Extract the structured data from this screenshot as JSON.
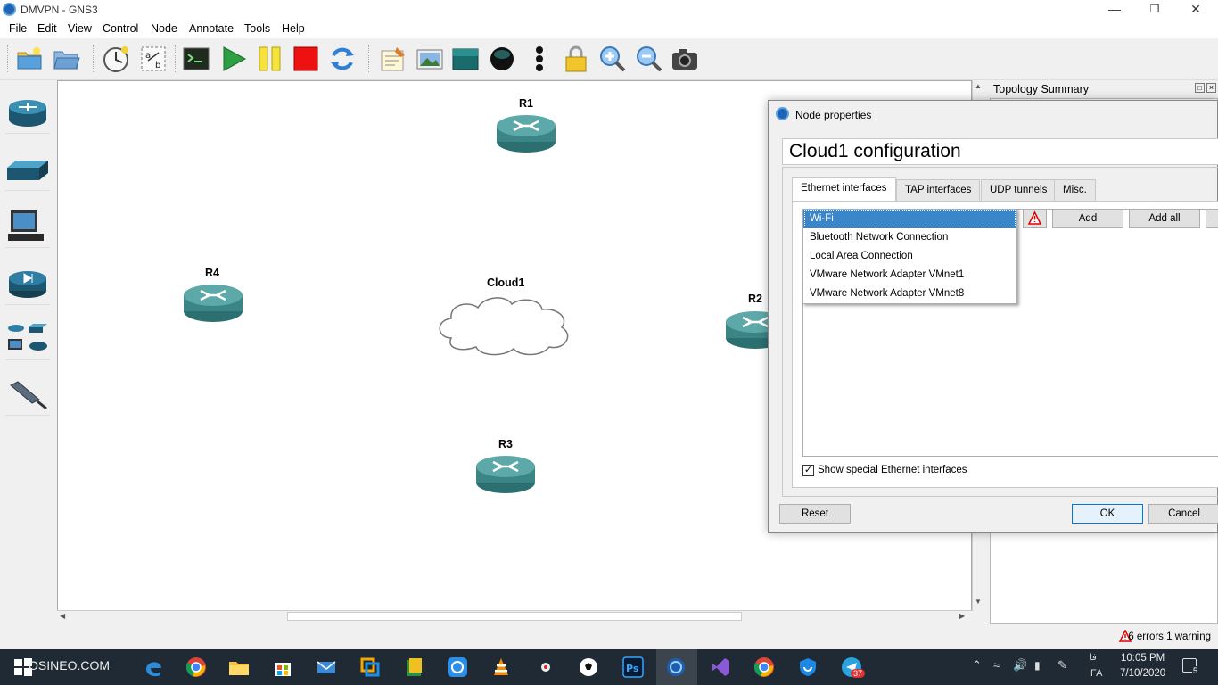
{
  "window": {
    "title": "DMVPN - GNS3",
    "controls": {
      "minimize": "—",
      "restore": "❐",
      "close": "✕"
    }
  },
  "menu": [
    "File",
    "Edit",
    "View",
    "Control",
    "Node",
    "Annotate",
    "Tools",
    "Help"
  ],
  "toolbar": {
    "icons": [
      "new-project-icon",
      "open-project-icon",
      "snapshot-clock-icon",
      "show-interface-labels-icon",
      "console-icon",
      "start-icon",
      "suspend-icon",
      "stop-icon",
      "reload-icon",
      "add-note-icon",
      "insert-image-icon",
      "draw-rectangle-icon",
      "draw-ellipse-icon",
      "more-icon",
      "lock-icon",
      "zoom-in-icon",
      "zoom-out-icon",
      "screenshot-icon"
    ]
  },
  "dock": {
    "items": [
      "routers-icon",
      "switches-icon",
      "end-devices-icon",
      "security-devices-icon",
      "all-devices-icon",
      "add-link-icon"
    ]
  },
  "canvas": {
    "nodes": [
      {
        "name": "R1",
        "type": "router"
      },
      {
        "name": "R4",
        "type": "router"
      },
      {
        "name": "Cloud1",
        "type": "cloud"
      },
      {
        "name": "R2",
        "type": "router"
      },
      {
        "name": "R3",
        "type": "router"
      }
    ]
  },
  "topology_summary": {
    "title": "Topology Summary"
  },
  "status": {
    "text": "6 errors 1 warning"
  },
  "dialog": {
    "title": "Node properties",
    "config_title": "Cloud1 configuration",
    "tabs": [
      "Ethernet interfaces",
      "TAP interfaces",
      "UDP tunnels",
      "Misc."
    ],
    "active_tab": "Ethernet interfaces",
    "interface_options": [
      "Wi-Fi",
      "Bluetooth Network Connection",
      "Local Area Connection",
      "VMware Network Adapter VMnet1",
      "VMware Network Adapter VMnet8"
    ],
    "selected_interface": "Wi-Fi",
    "add_label": "Add",
    "add_all_label": "Add all",
    "show_special_label": "Show special Ethernet interfaces",
    "show_special_checked": true,
    "reset_label": "Reset",
    "ok_label": "OK",
    "cancel_label": "Cancel"
  },
  "taskbar": {
    "watermark": "OSINEO.COM",
    "icons": [
      "start-icon",
      "search-icon",
      "task-view-icon",
      "edge-icon",
      "chrome-icon",
      "file-explorer-icon",
      "store-icon",
      "mail-icon",
      "vmware-icon",
      "dictionary-icon",
      "sync-icon",
      "vlc-icon",
      "daemon-icon",
      "football-icon",
      "photoshop-icon",
      "gns3-icon",
      "visual-studio-icon",
      "chrome-profile-icon",
      "shield-icon",
      "telegram-icon"
    ],
    "telegram_badge": "37",
    "lang_top": "فا",
    "lang": "FA",
    "time": "10:05 PM",
    "date": "7/10/2020",
    "notif_count": "5"
  }
}
